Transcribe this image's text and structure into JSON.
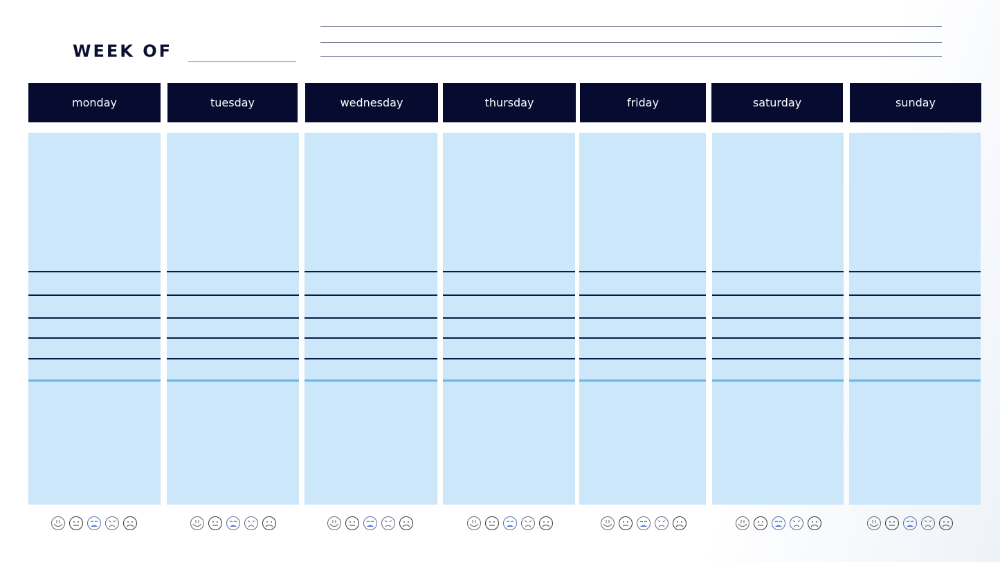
{
  "header": {
    "title": "WEEK OF",
    "week_value": "",
    "note_lines": [
      "",
      "",
      ""
    ]
  },
  "colors": {
    "header_bg": "#060b2f",
    "column_bg": "#cce6fa",
    "separator": "#6ab4e6",
    "rule": "#0d1a45"
  },
  "days": [
    {
      "label": "monday"
    },
    {
      "label": "tuesday"
    },
    {
      "label": "wednesday"
    },
    {
      "label": "thursday"
    },
    {
      "label": "friday"
    },
    {
      "label": "saturday"
    },
    {
      "label": "sunday"
    }
  ],
  "moods": [
    "happy",
    "neutral",
    "crying",
    "angry",
    "sad"
  ]
}
